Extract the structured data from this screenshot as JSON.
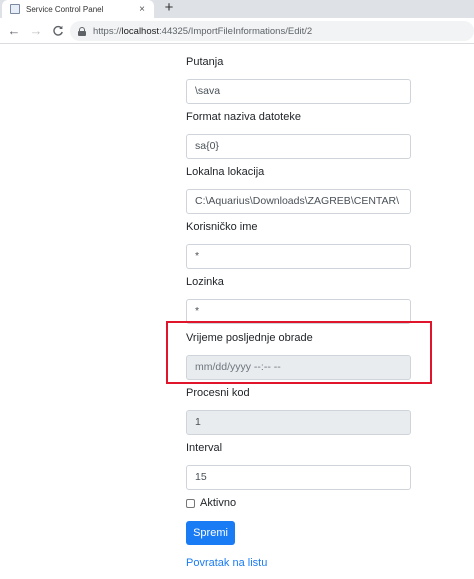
{
  "browser": {
    "tab_title": "Service Control Panel",
    "tab_close": "×",
    "new_tab": "+",
    "back": "←",
    "forward": "→",
    "reload": "C",
    "url_scheme": "https://",
    "url_host": "localhost",
    "url_rest": ":44325/ImportFileInformations/Edit/2"
  },
  "form": {
    "putanja": {
      "label": "Putanja",
      "value": "\\sava"
    },
    "format": {
      "label": "Format naziva datoteke",
      "value": "sa{0}"
    },
    "lokalna": {
      "label": "Lokalna lokacija",
      "value": "C:\\Aquarius\\Downloads\\ZAGREB\\CENTAR\\"
    },
    "korisnicko": {
      "label": "Korisničko ime",
      "value": "*"
    },
    "lozinka": {
      "label": "Lozinka",
      "value": "*"
    },
    "vrijeme": {
      "label": "Vrijeme posljednje obrade",
      "value": "mm/dd/yyyy --:-- --"
    },
    "procesni": {
      "label": "Procesni kod",
      "value": "1"
    },
    "interval": {
      "label": "Interval",
      "value": "15"
    },
    "aktivno": {
      "label": "Aktivno",
      "checked": false
    },
    "submit_label": "Spremi",
    "back_link": "Povratak na listu"
  },
  "colors": {
    "primary": "#1a7cf5",
    "highlight_border": "#e0142a"
  }
}
